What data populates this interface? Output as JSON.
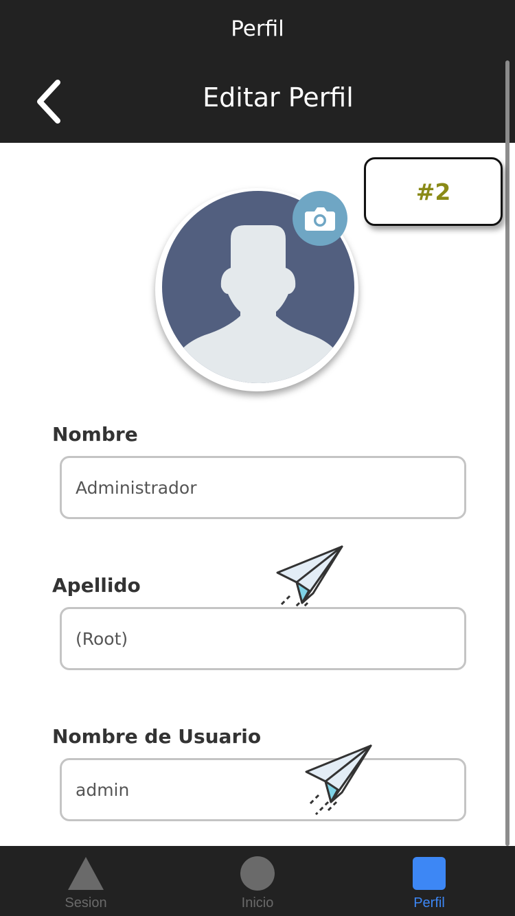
{
  "status_bar": {
    "title": "Perfil"
  },
  "nav": {
    "title": "Editar Perfil",
    "back_icon": "chevron-left-icon"
  },
  "badge": {
    "label": "#2",
    "color": "#8a8a17"
  },
  "avatar": {
    "icon": "user-silhouette-icon",
    "background": "#525f7f",
    "camera_icon": "camera-icon"
  },
  "form": {
    "nombre": {
      "label": "Nombre",
      "value": "Administrador"
    },
    "apellido": {
      "label": "Apellido",
      "value": "(Root)"
    },
    "usuario": {
      "label": "Nombre de Usuario",
      "value": "admin"
    }
  },
  "tabs": [
    {
      "label": "Sesion",
      "icon": "triangle-icon",
      "active": false
    },
    {
      "label": "Inicio",
      "icon": "circle-icon",
      "active": false
    },
    {
      "label": "Perfil",
      "icon": "square-icon",
      "active": true
    }
  ],
  "colors": {
    "bar_background": "#222222",
    "active_tab": "#3d87f5",
    "inactive_tab": "#6a6a6a"
  }
}
